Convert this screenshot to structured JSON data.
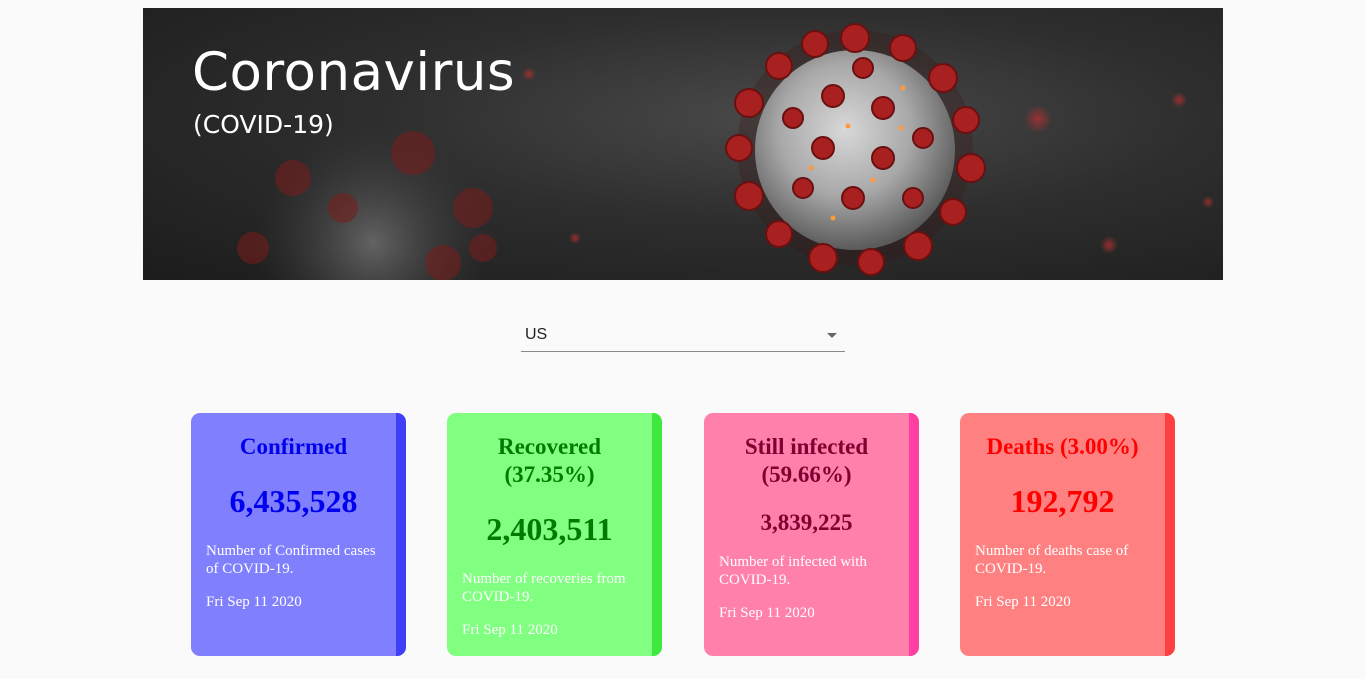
{
  "banner": {
    "title": "Coronavirus",
    "subtitle": "(COVID-19)"
  },
  "country_select": {
    "value": "US",
    "icon": "chevron-down-icon"
  },
  "cards": {
    "confirmed": {
      "title": "Confirmed",
      "value": "6,435,528",
      "description": "Number of Confirmed cases of COVID-19.",
      "date": "Fri Sep 11 2020",
      "color": "#8080ff",
      "accent": "#0000ee"
    },
    "recovered": {
      "title_line1": "Recovered",
      "title_line2": "(37.35%)",
      "value": "2,403,511",
      "description": "Number of recoveries from COVID-19.",
      "date": "Fri Sep 11 2020",
      "color": "#80ff80",
      "accent": "#007a00"
    },
    "infected": {
      "title_line1": "Still infected",
      "title_line2": "(59.66%)",
      "value": "3,839,225",
      "description": "Number of infected with COVID-19.",
      "date": "Fri Sep 11 2020",
      "color": "#ff80aa",
      "accent": "#800030"
    },
    "deaths": {
      "title": "Deaths (3.00%)",
      "value": "192,792",
      "description": "Number of deaths case of COVID-19.",
      "date": "Fri Sep 11 2020",
      "color": "#ff8080",
      "accent": "#ff0000"
    }
  }
}
